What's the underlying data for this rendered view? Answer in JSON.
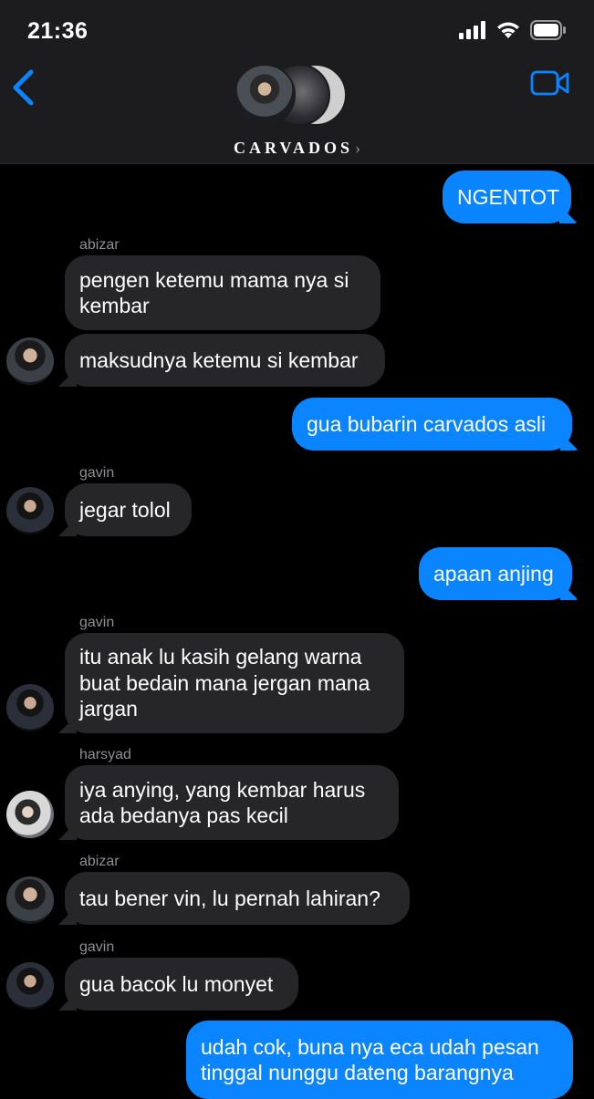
{
  "status": {
    "time": "21:36"
  },
  "header": {
    "group_name": "CARVADOS",
    "chevron": "›"
  },
  "messages": [
    {
      "dir": "out",
      "text": "NGENTOT"
    },
    {
      "sender": "abizar"
    },
    {
      "dir": "in",
      "text": "pengen ketemu mama nya si kembar"
    },
    {
      "dir": "in",
      "text": "maksudnya ketemu si kembar"
    },
    {
      "dir": "out",
      "text": "gua bubarin carvados asli"
    },
    {
      "sender": "gavin"
    },
    {
      "dir": "in",
      "text": "jegar tolol"
    },
    {
      "dir": "out",
      "text": "apaan anjing"
    },
    {
      "sender": "gavin"
    },
    {
      "dir": "in",
      "text": "itu anak lu kasih gelang warna buat bedain mana jergan mana jargan"
    },
    {
      "sender": "harsyad"
    },
    {
      "dir": "in",
      "text": "iya anying, yang kembar harus ada bedanya pas kecil"
    },
    {
      "sender": "abizar"
    },
    {
      "dir": "in",
      "text": "tau bener vin, lu pernah lahiran?"
    },
    {
      "sender": "gavin"
    },
    {
      "dir": "in",
      "text": "gua bacok lu monyet"
    },
    {
      "dir": "out",
      "text": "udah cok, buna nya eca udah pesan tinggal nunggu dateng barangnya"
    }
  ],
  "colors": {
    "outgoing": "#0a84ff",
    "incoming": "#262628",
    "header": "#1c1c1e"
  }
}
